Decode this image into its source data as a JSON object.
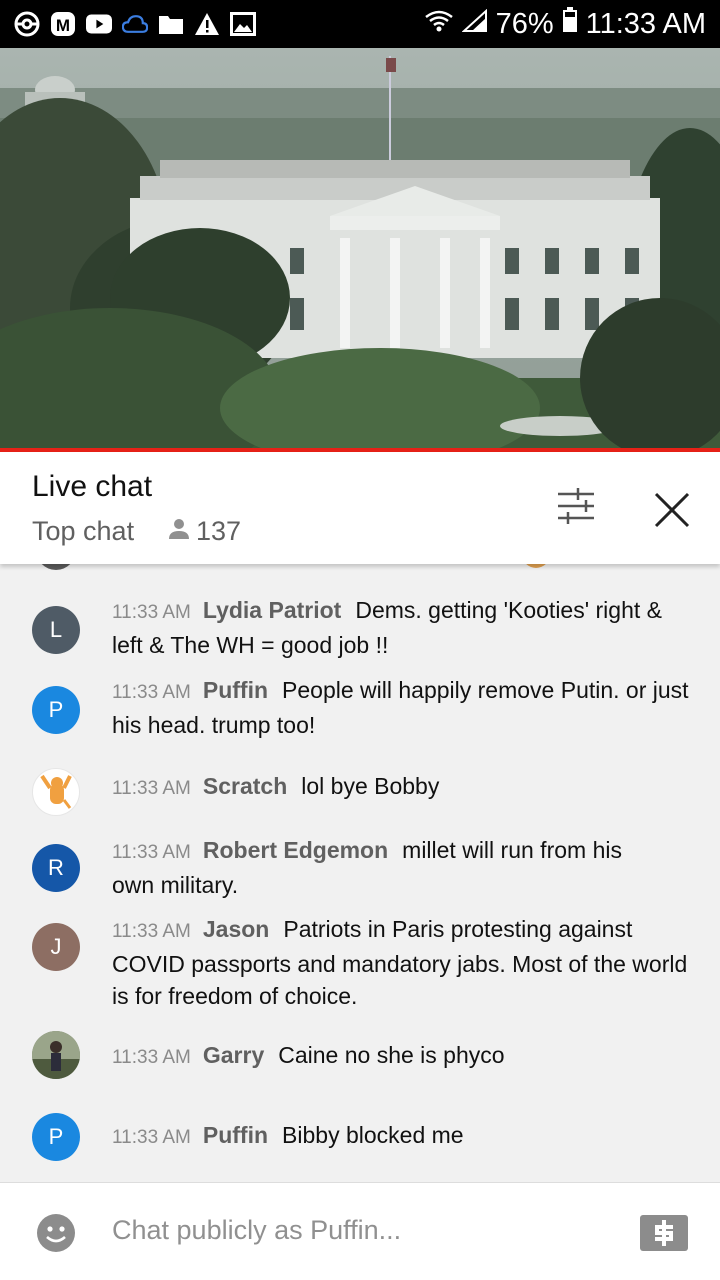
{
  "status_bar": {
    "battery": "76%",
    "time": "11:33 AM",
    "left_icons": [
      "pokeball-icon",
      "m-app-icon",
      "youtube-icon",
      "cloud-icon",
      "folder-icon",
      "warning-icon",
      "image-icon"
    ]
  },
  "chat": {
    "title": "Live chat",
    "mode": "Top chat",
    "viewer_count": "137"
  },
  "messages": [
    {
      "time": "11:33 AM",
      "author": "Lydia Patriot",
      "text": "Dems. getting 'Kooties' right & left & The WH = good job !!",
      "avatar_letter": "L",
      "avatar_color": "#4f5b66"
    },
    {
      "time": "11:33 AM",
      "author": "Puffin",
      "text": "People will happily remove Putin. or just his head. trump too!",
      "avatar_letter": "P",
      "avatar_color": "#1a88e0"
    },
    {
      "time": "11:33 AM",
      "author": "Scratch",
      "text": "lol bye Bobby",
      "avatar_letter": "",
      "avatar_color": "#ffffff"
    },
    {
      "time": "11:33 AM",
      "author": "Robert Edgemon",
      "text": "millet will run from his own military.",
      "avatar_letter": "R",
      "avatar_color": "#1557a8"
    },
    {
      "time": "11:33 AM",
      "author": "Jason",
      "text": "Patriots in Paris protesting against COVID passports and mandatory jabs. Most of the world is for freedom of choice.",
      "avatar_letter": "J",
      "avatar_color": "#8d6e63"
    },
    {
      "time": "11:33 AM",
      "author": "Garry",
      "text": "Caine no she is phyco",
      "avatar_letter": "",
      "avatar_color": "#6b7a5a"
    },
    {
      "time": "11:33 AM",
      "author": "Puffin",
      "text": "Bibby blocked me",
      "avatar_letter": "P",
      "avatar_color": "#1a88e0"
    }
  ],
  "input": {
    "placeholder": "Chat publicly as Puffin..."
  },
  "colors": {
    "accent_red": "#e62117",
    "status_bg": "#000000"
  }
}
